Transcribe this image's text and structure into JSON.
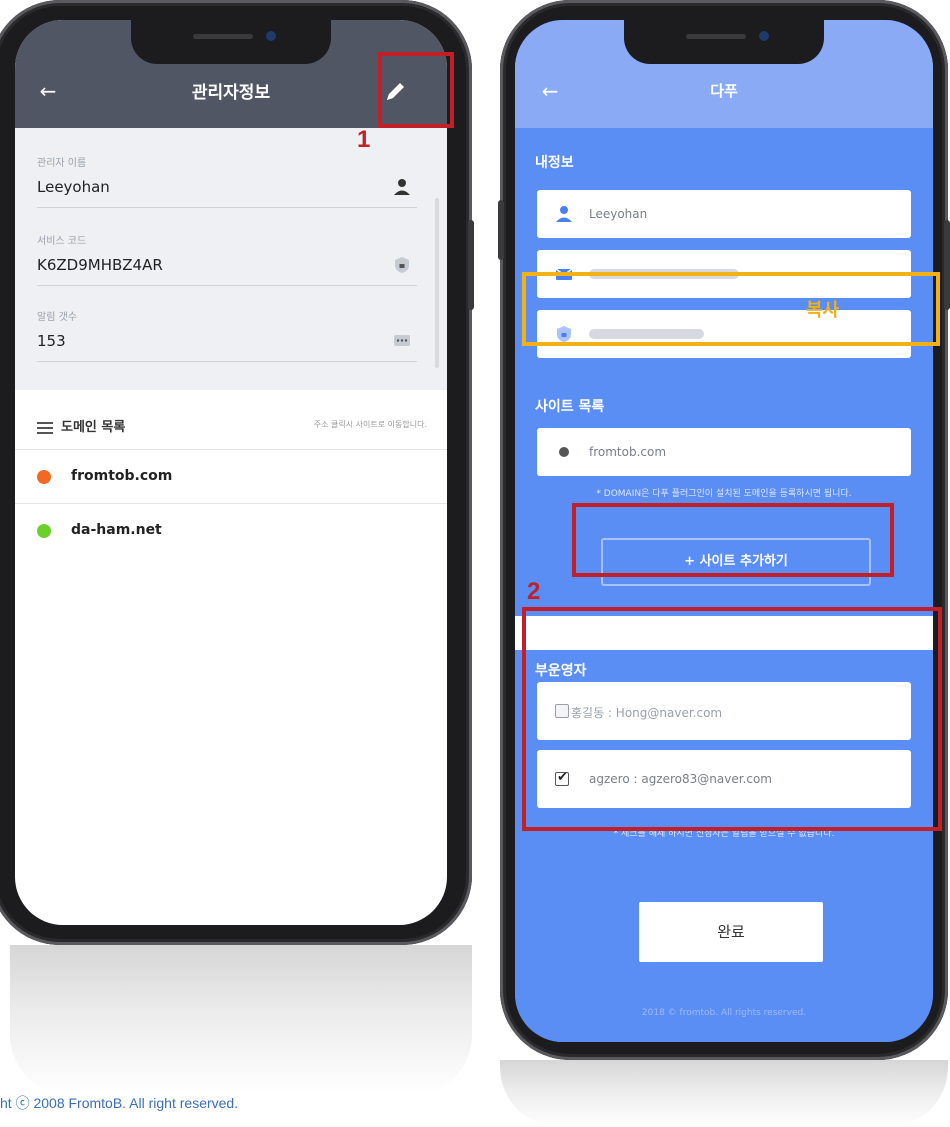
{
  "left_screen": {
    "header": {
      "title": "관리자정보"
    },
    "fields": [
      {
        "label": "관리자 이름",
        "value": "Leeyohan",
        "icon": "person-icon"
      },
      {
        "label": "서비스 코드",
        "value": "K6ZD9MHBZ4AR",
        "icon": "shield-icon"
      },
      {
        "label": "알림 갯수",
        "value": "153",
        "icon": "message-icon"
      }
    ],
    "domain_section": {
      "title": "도메인 목록",
      "note": "주소 클릭시 사이트로 이동합니다.",
      "items": [
        {
          "label": "fromtob.com",
          "color": "#f26a22"
        },
        {
          "label": "da-ham.net",
          "color": "#6ad12a"
        }
      ]
    }
  },
  "right_screen": {
    "header": {
      "title": "다푸"
    },
    "my_info": {
      "title": "내정보",
      "name": "Leeyohan"
    },
    "site_list": {
      "title": "사이트 목록",
      "site": "fromtob.com",
      "note": "* DOMAIN은 다푸 플러그인이 설치된 도메인을 등록하시면 됩니다.",
      "add_button": "+ 사이트 추가하기"
    },
    "sub_operators": {
      "title": "부운영자",
      "items": [
        {
          "label": "홍길동 : Hong@naver.com",
          "checked": false
        },
        {
          "label": "agzero : agzero83@naver.com",
          "checked": true
        }
      ],
      "note": "* 체크를 해제 하시면 신청자는 알림을 받으실 수 없습니다."
    },
    "done_button": "완료",
    "footer": "2018 © fromtob. All rights reserved."
  },
  "annotations": {
    "step1": "1",
    "step2": "2",
    "copy_label": "복사"
  },
  "copyright": "ht ⓒ 2008 FromtoB. All right reserved.",
  "colors": {
    "left_header": "#505664",
    "right_bg": "#5b8ef5",
    "highlight_red": "#c21f26",
    "highlight_yellow": "#f2b216"
  }
}
